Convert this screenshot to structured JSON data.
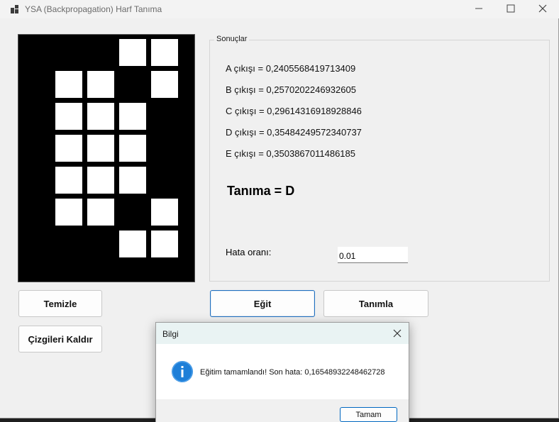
{
  "window": {
    "title": "YSA (Backpropagation) Harf Tanıma"
  },
  "grid": {
    "rows": 7,
    "cols": 5,
    "cells": [
      [
        0,
        0,
        0,
        1,
        1
      ],
      [
        0,
        1,
        1,
        0,
        1
      ],
      [
        0,
        1,
        1,
        1,
        0
      ],
      [
        0,
        1,
        1,
        1,
        0
      ],
      [
        0,
        1,
        1,
        1,
        0
      ],
      [
        0,
        1,
        1,
        0,
        1
      ],
      [
        0,
        0,
        0,
        1,
        1
      ]
    ]
  },
  "results": {
    "legend": "Sonuçlar",
    "outputs": [
      "A çıkışı = 0,2405568419713409",
      "B çıkışı = 0,2570202246932605",
      "C çıkışı = 0,29614316918928846",
      "D çıkışı = 0,35484249572340737",
      "E çıkışı = 0,3503867011486185"
    ],
    "recognition": "Tanıma = D",
    "error_label": "Hata oranı:",
    "error_value": "0.01"
  },
  "buttons": {
    "clear": "Temizle",
    "remove_lines": "Çizgileri Kaldır",
    "train": "Eğit",
    "recognize": "Tanımla"
  },
  "dialog": {
    "title": "Bilgi",
    "message": "Eğitim tamamlandı! Son hata: 0,16548932248462728",
    "ok": "Tamam",
    "icon": "info-icon"
  },
  "colors": {
    "accent": "#1f6fbf",
    "info_icon": "#1e7fd8"
  }
}
